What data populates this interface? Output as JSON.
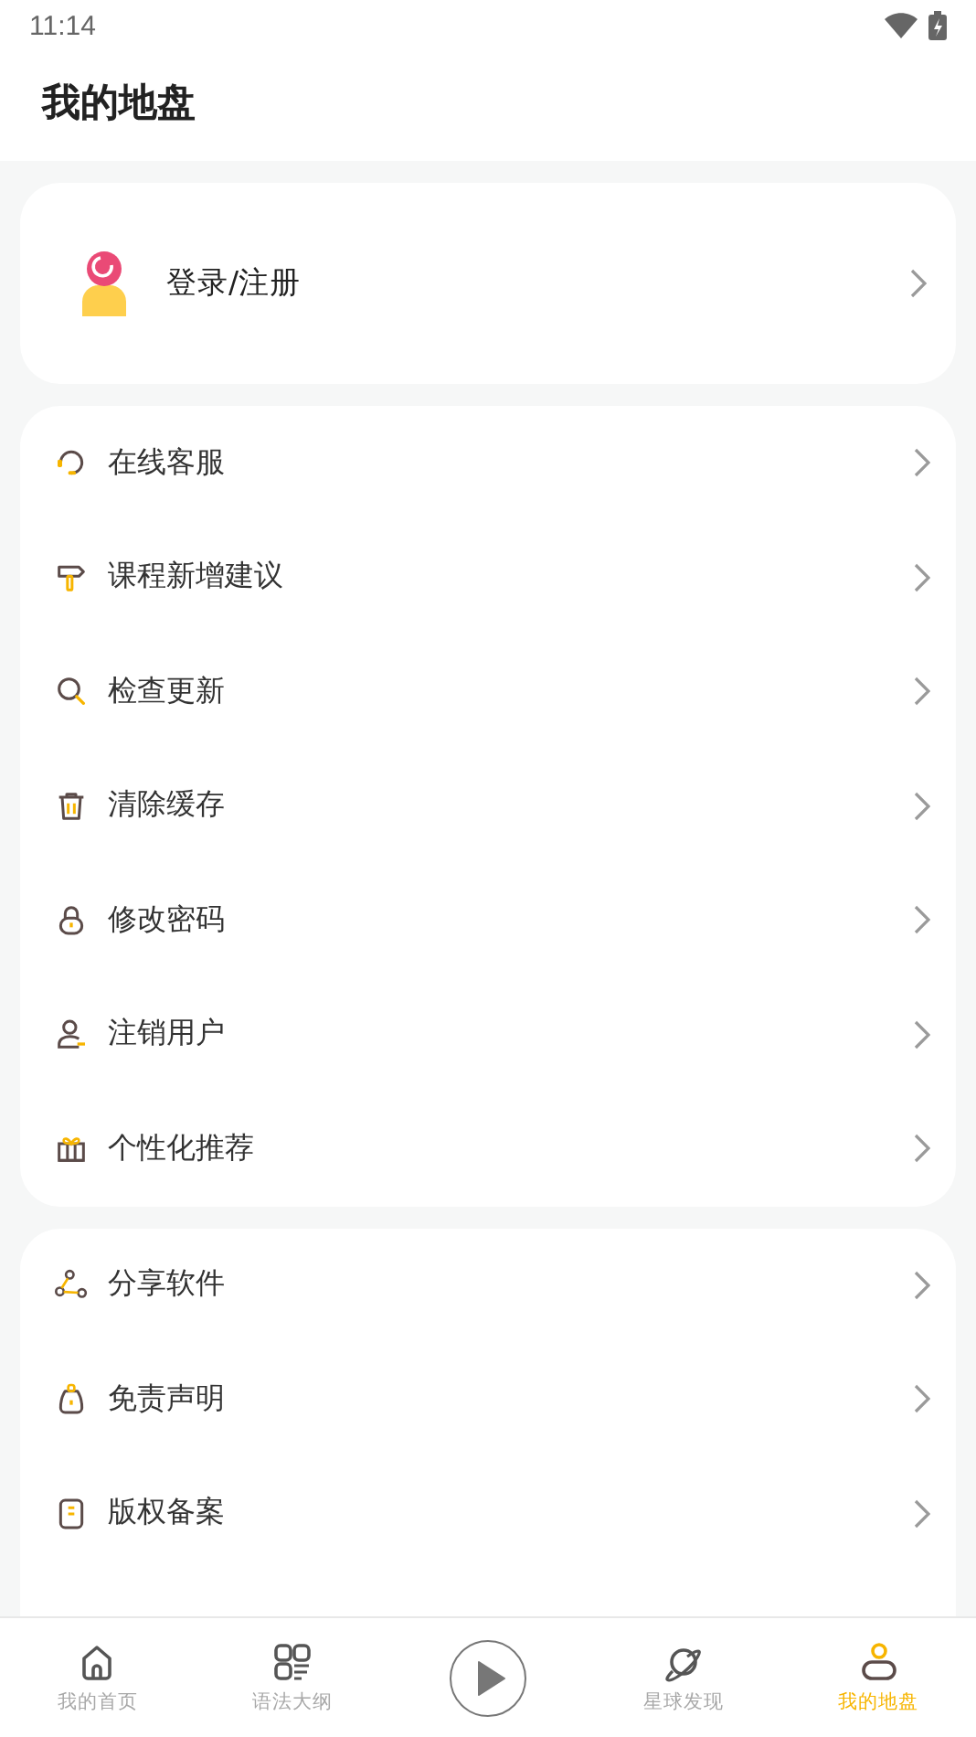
{
  "status_bar": {
    "time": "11:14"
  },
  "header": {
    "title": "我的地盘"
  },
  "account": {
    "label": "登录/注册"
  },
  "menu_groups": [
    {
      "items": [
        {
          "label": "在线客服"
        },
        {
          "label": "课程新增建议"
        },
        {
          "label": "检查更新"
        },
        {
          "label": "清除缓存"
        },
        {
          "label": "修改密码"
        },
        {
          "label": "注销用户"
        },
        {
          "label": "个性化推荐"
        }
      ]
    },
    {
      "items": [
        {
          "label": "分享软件"
        },
        {
          "label": "免责声明"
        },
        {
          "label": "版权备案"
        }
      ]
    }
  ],
  "bottom_nav": [
    {
      "kind": "tab",
      "label": "我的首页",
      "selected": false
    },
    {
      "kind": "tab",
      "label": "语法大纲",
      "selected": false
    },
    {
      "kind": "play"
    },
    {
      "kind": "tab",
      "label": "星球发现",
      "selected": false
    },
    {
      "kind": "tab",
      "label": "我的地盘",
      "selected": true
    }
  ]
}
